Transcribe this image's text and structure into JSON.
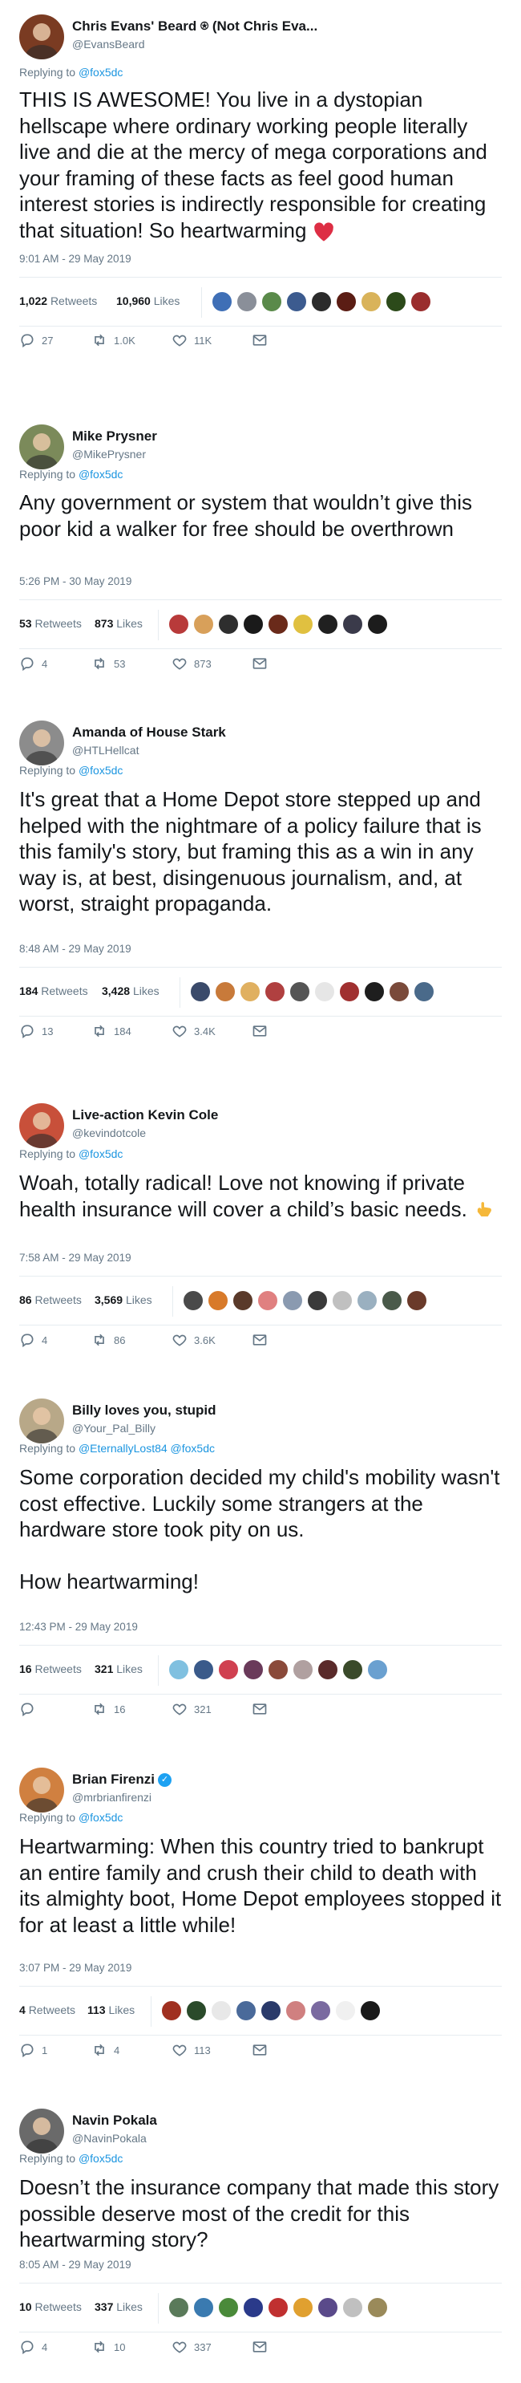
{
  "labels": {
    "retweets": "Retweets",
    "likes": "Likes",
    "replying_to": "Replying to"
  },
  "colors": {
    "link": "#1b95e0",
    "muted": "#657786",
    "text": "#14171a",
    "divider": "#e6ecf0",
    "verified": "#1da1f2"
  },
  "tweets": [
    {
      "display_name": "Chris Evans' Beard ⍟ (Not Chris Eva...",
      "username": "@EvansBeard",
      "reply_to": [
        "@fox5dc"
      ],
      "text": "THIS IS AWESOME! You live in a dystopian hellscape where ordinary working people literally live and die at the mercy of mega corporations and your framing of these facts as feel good human interest stories is indirectly responsible for creating that situation! So heartwarming",
      "emoji": "heart-emoji",
      "timestamp": "9:01 AM - 29 May 2019",
      "retweets": "1,022",
      "likes": "10,960",
      "replies_count": "27",
      "retweet_count_short": "1.0K",
      "like_count_short": "11K",
      "avatar_color": "#7a3b22",
      "face_colors": [
        "#3f6fb6",
        "#8a8f99",
        "#5a8a4a",
        "#3c5b8f",
        "#2b2b2b",
        "#5b1d14",
        "#d9b35a",
        "#2c4a1a",
        "#9a2d2d"
      ]
    },
    {
      "display_name": "Mike Prysner",
      "username": "@MikePrysner",
      "reply_to": [
        "@fox5dc"
      ],
      "text": "Any government or system that wouldn’t give this poor kid a walker for free should be overthrown",
      "timestamp": "5:26 PM - 30 May 2019",
      "retweets": "53",
      "likes": "873",
      "replies_count": "4",
      "retweet_count_short": "53",
      "like_count_short": "873",
      "avatar_color": "#7b8a5a",
      "face_colors": [
        "#b83a3a",
        "#d8a05a",
        "#2e2e2e",
        "#1a1a1a",
        "#6a2a1a",
        "#e0c040",
        "#202020",
        "#3a3a4a",
        "#1c1c1c"
      ]
    },
    {
      "display_name": "Amanda of House Stark",
      "username": "@HTLHellcat",
      "reply_to": [
        "@fox5dc"
      ],
      "text": "It's great that a Home Depot store stepped up and helped with the nightmare of a policy failure that is this family's story, but framing this as a win in any way is, at best, disingenuous journalism, and, at worst, straight propaganda.",
      "timestamp": "8:48 AM - 29 May 2019",
      "retweets": "184",
      "likes": "3,428",
      "replies_count": "13",
      "retweet_count_short": "184",
      "like_count_short": "3.4K",
      "avatar_color": "#8c8c8c",
      "face_colors": [
        "#3a4a6a",
        "#c87a3a",
        "#e0b060",
        "#b04040",
        "#555555",
        "#e6e6e6",
        "#a03030",
        "#1e1e1e",
        "#7a4a3a",
        "#4a6a8a"
      ]
    },
    {
      "display_name": "Live-action Kevin Cole",
      "username": "@kevindotcole",
      "reply_to": [
        "@fox5dc"
      ],
      "text": "Woah, totally radical! Love not knowing if private health insurance will cover a child’s basic needs.",
      "emoji": "hand-emoji",
      "timestamp": "7:58 AM - 29 May 2019",
      "retweets": "86",
      "likes": "3,569",
      "replies_count": "4",
      "retweet_count_short": "86",
      "like_count_short": "3.6K",
      "avatar_color": "#c8503a",
      "face_colors": [
        "#4a4a4a",
        "#d87a2a",
        "#5a3a2a",
        "#e08080",
        "#8a9ab0",
        "#3a3a3a",
        "#c0c0c0",
        "#9ab0c0",
        "#4a5a4a",
        "#6a3a2a"
      ]
    },
    {
      "display_name": "Billy loves you, stupid",
      "username": "@Your_Pal_Billy",
      "reply_to": [
        "@EternallyLost84",
        "@fox5dc"
      ],
      "text": "Some corporation decided my child's mobility wasn't cost effective. Luckily some strangers at the hardware store took pity on us.\n\nHow heartwarming!",
      "timestamp": "12:43 PM - 29 May 2019",
      "retweets": "16",
      "likes": "321",
      "replies_count": "",
      "retweet_count_short": "16",
      "like_count_short": "321",
      "avatar_color": "#b8a888",
      "face_colors": [
        "#80c0e0",
        "#3a5a8a",
        "#d04050",
        "#6a3a5a",
        "#8a4a3a",
        "#b0a0a0",
        "#5a2a2a",
        "#3a4a2a",
        "#6aa0d0"
      ]
    },
    {
      "display_name": "Brian Firenzi",
      "username": "@mrbrianfirenzi",
      "verified": true,
      "reply_to": [
        "@fox5dc"
      ],
      "text": "Heartwarming: When this country tried to bankrupt an entire family and crush their child to death with its almighty boot, Home Depot employees stopped it for at least a little while!",
      "timestamp": "3:07 PM - 29 May 2019",
      "retweets": "4",
      "likes": "113",
      "replies_count": "1",
      "retweet_count_short": "4",
      "like_count_short": "113",
      "avatar_color": "#d08040",
      "face_colors": [
        "#a03020",
        "#2a4a2a",
        "#e8e8e8",
        "#4a6a9a",
        "#2a3a6a",
        "#d08080",
        "#7a6aa0",
        "#f0f0f0",
        "#1a1a1a"
      ]
    },
    {
      "display_name": "Navin Pokala",
      "username": "@NavinPokala",
      "reply_to": [
        "@fox5dc"
      ],
      "text": "Doesn’t the insurance company that made this story possible deserve most of the credit for this heartwarming story?",
      "timestamp": "8:05 AM - 29 May 2019",
      "retweets": "10",
      "likes": "337",
      "replies_count": "4",
      "retweet_count_short": "10",
      "like_count_short": "337",
      "avatar_color": "#6a6a6a",
      "face_colors": [
        "#5a7a5a",
        "#3a7ab0",
        "#4a8a3a",
        "#2a3a8a",
        "#c03030",
        "#e0a030",
        "#5a4a8a",
        "#c0c0c0",
        "#9a8a5a"
      ]
    }
  ]
}
